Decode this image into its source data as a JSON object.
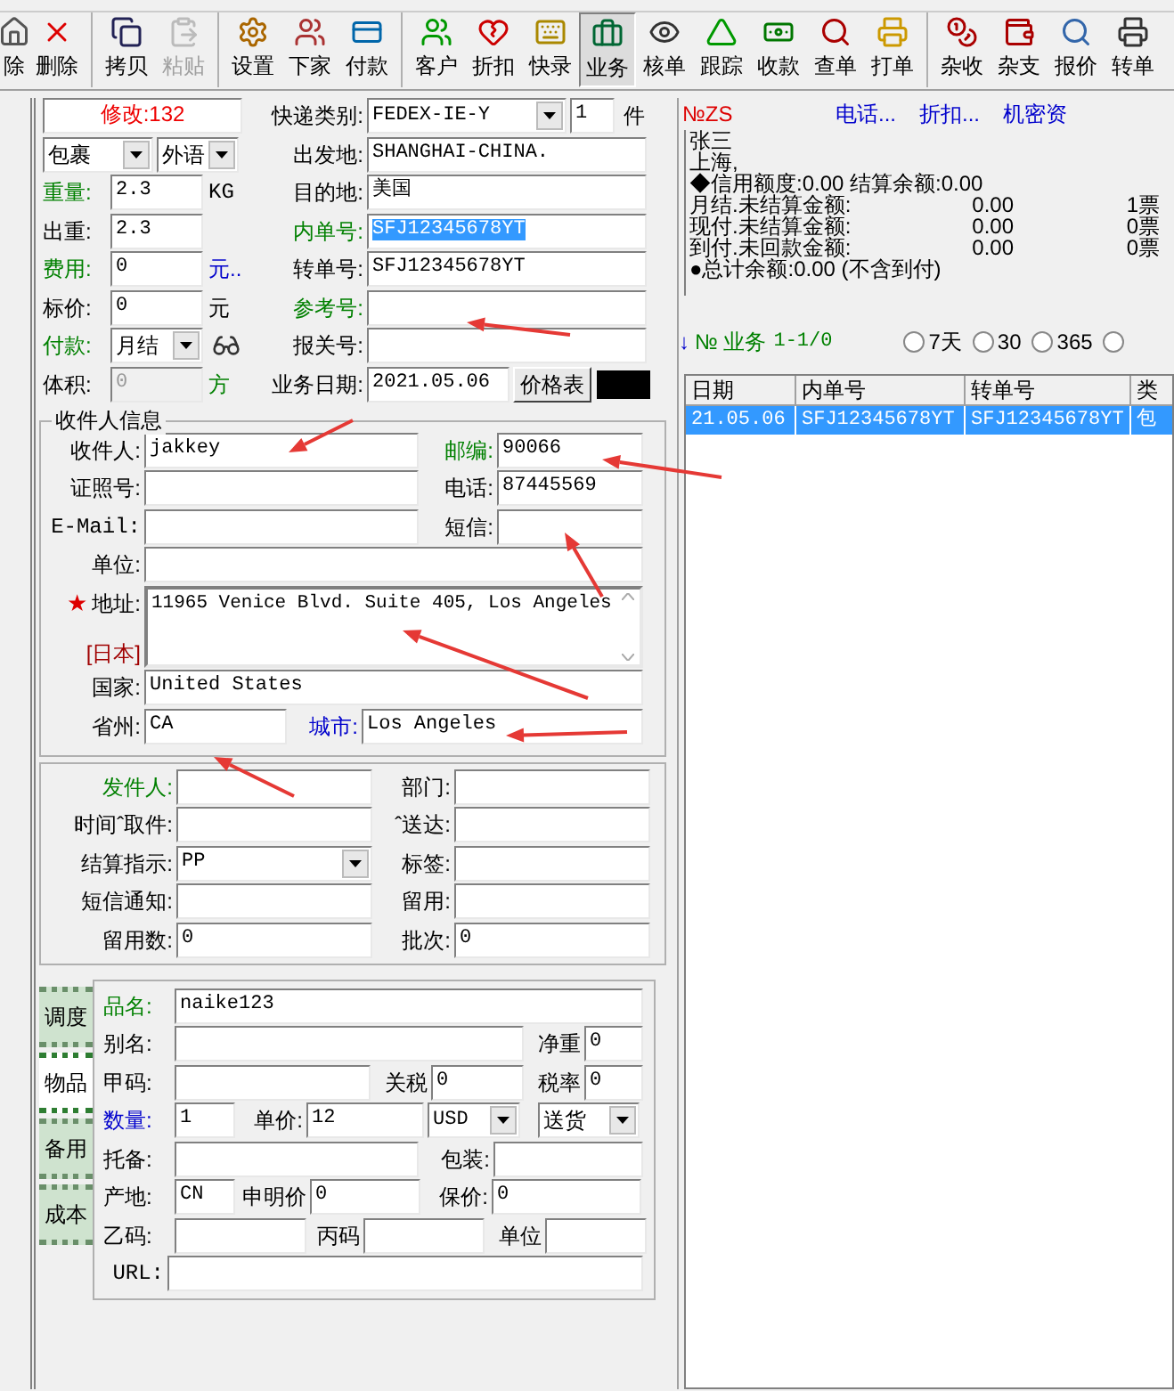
{
  "toolbar": {
    "groups": [
      [
        {
          "label": "除",
          "selected": false,
          "disabled": false
        },
        {
          "label": "删除",
          "selected": false,
          "disabled": false
        }
      ],
      [
        {
          "label": "拷贝",
          "selected": false,
          "disabled": false
        },
        {
          "label": "粘贴",
          "selected": false,
          "disabled": true
        }
      ],
      [
        {
          "label": "设置",
          "selected": false,
          "disabled": false
        },
        {
          "label": "下家",
          "selected": false,
          "disabled": false
        },
        {
          "label": "付款",
          "selected": false,
          "disabled": false
        }
      ],
      [
        {
          "label": "客户",
          "selected": false,
          "disabled": false
        },
        {
          "label": "折扣",
          "selected": false,
          "disabled": false
        },
        {
          "label": "快录",
          "selected": false,
          "disabled": false
        },
        {
          "label": "业务",
          "selected": true,
          "disabled": false
        },
        {
          "label": "核单",
          "selected": false,
          "disabled": false
        },
        {
          "label": "跟踪",
          "selected": false,
          "disabled": false
        },
        {
          "label": "收款",
          "selected": false,
          "disabled": false
        },
        {
          "label": "查单",
          "selected": false,
          "disabled": false
        },
        {
          "label": "打单",
          "selected": false,
          "disabled": false
        }
      ],
      [
        {
          "label": "杂收",
          "selected": false,
          "disabled": false
        },
        {
          "label": "杂支",
          "selected": false,
          "disabled": false
        },
        {
          "label": "报价",
          "selected": false,
          "disabled": false
        },
        {
          "label": "转单",
          "selected": false,
          "disabled": false
        }
      ]
    ]
  },
  "shipment": {
    "status": "修改:132",
    "express_type": {
      "label": "快递类别:",
      "value": "FEDEX-IE-Y"
    },
    "pieces": {
      "value": "1",
      "unit": "件"
    },
    "package_type": "包裹",
    "language": "外语",
    "origin": {
      "label": "出发地:",
      "value": "SHANGHAI-CHINA."
    },
    "weight": {
      "label": "重量:",
      "value": "2.3",
      "unit": "KG"
    },
    "destination": {
      "label": "目的地:",
      "value": "美国"
    },
    "out_weight": {
      "label": "出重:",
      "value": "2.3"
    },
    "internal_no": {
      "label": "内单号:",
      "value": "SFJ12345678YT",
      "selected": true
    },
    "fee": {
      "label": "费用:",
      "value": "0",
      "unit": "元.."
    },
    "transfer_no": {
      "label": "转单号:",
      "value": "SFJ12345678YT"
    },
    "list_price": {
      "label": "标价:",
      "value": "0",
      "unit": "元"
    },
    "reference_no": {
      "label": "参考号:"
    },
    "payment": {
      "label": "付款:",
      "value": "月结"
    },
    "customs_no": {
      "label": "报关号:"
    },
    "volume": {
      "label": "体积:",
      "value": "0",
      "unit": "方",
      "disabled": true
    },
    "business_date": {
      "label": "业务日期:",
      "value": "2021.05.06"
    },
    "price_table_button": "价格表"
  },
  "receiver": {
    "title": "收件人信息",
    "name": {
      "label": "收件人:",
      "value": "jakkey"
    },
    "postcode": {
      "label": "邮编:",
      "value": "90066"
    },
    "id_no": {
      "label": "证照号:"
    },
    "phone": {
      "label": "电话:",
      "value": "87445569"
    },
    "email": {
      "label": "E-Mail:"
    },
    "sms": {
      "label": "短信:"
    },
    "company": {
      "label": "单位:"
    },
    "address": {
      "required_mark": "★",
      "label": "地址:",
      "value": "11965 Venice Blvd. Suite 405, Los Angeles"
    },
    "region_tag": "[日本]",
    "country": {
      "label": "国家:",
      "value": "United States"
    },
    "state": {
      "label": "省州:",
      "value": "CA"
    },
    "city": {
      "label": "城市:",
      "value": "Los Angeles"
    }
  },
  "sender": {
    "rows": [
      [
        {
          "label": "发件人:",
          "kind": "input",
          "color": "#008000"
        },
        {
          "label": "部门:",
          "kind": "input"
        }
      ],
      [
        {
          "label": "时间ˆ取件:",
          "kind": "input"
        },
        {
          "label": "ˆ送达:",
          "kind": "input"
        }
      ],
      [
        {
          "label": "结算指示:",
          "kind": "select",
          "value": "PP"
        },
        {
          "label": "标签:",
          "kind": "input"
        }
      ],
      [
        {
          "label": "短信通知:",
          "kind": "input"
        },
        {
          "label": "留用:",
          "kind": "input"
        }
      ],
      [
        {
          "label": "留用数:",
          "kind": "input",
          "value": "0"
        },
        {
          "label": "批次:",
          "kind": "input",
          "value": "0"
        }
      ]
    ]
  },
  "item": {
    "tabs": [
      {
        "label": "调度",
        "selected": false
      },
      {
        "label": "物品",
        "selected": true
      },
      {
        "label": "备用",
        "selected": false
      },
      {
        "label": "成本",
        "selected": false
      }
    ],
    "name": {
      "label": "品名:",
      "value": "naike123"
    },
    "alias": {
      "label": "别名:"
    },
    "net_weight": {
      "label": "净重",
      "value": "0"
    },
    "code_a": {
      "label": "甲码:"
    },
    "duty": {
      "label": "关税",
      "value": "0"
    },
    "tax_rate": {
      "label": "税率",
      "value": "0"
    },
    "quantity": {
      "label": "数量:",
      "value": "1"
    },
    "unit_price": {
      "label": "单价:",
      "value": "12"
    },
    "currency": "USD",
    "delivery": "送货",
    "remark": {
      "label": "托备:"
    },
    "packing": {
      "label": "包装:"
    },
    "origin": {
      "label": "产地:",
      "value": "CN"
    },
    "declared_value": {
      "label": "申明价",
      "value": "0"
    },
    "insured_value": {
      "label": "保价:",
      "value": "0"
    },
    "code_b": {
      "label": "乙码:"
    },
    "code_c": {
      "label": "丙码"
    },
    "unit": {
      "label": "单位"
    },
    "url": {
      "label": "URL:"
    }
  },
  "customer": {
    "code": "№ZS",
    "links": [
      "电话...",
      "折扣...",
      "机密资"
    ],
    "lines": [
      "张三",
      "上海,",
      "◆信用额度:0.00 结算余额:0.00"
    ],
    "balances": [
      {
        "label": "月结.未结算金额:",
        "amount": "0.00",
        "count": "1票"
      },
      {
        "label": "现付.未结算金额:",
        "amount": "0.00",
        "count": "0票"
      },
      {
        "label": "到付.未回款金额:",
        "amount": "0.00",
        "count": "0票"
      }
    ],
    "total": "●总计余额:0.00 (不含到付)"
  },
  "business": {
    "arrow": "↓",
    "title": "№ 业务",
    "range": "1-1/0",
    "ranges": [
      {
        "label": "7天",
        "selected": false
      },
      {
        "label": "30",
        "selected": false
      },
      {
        "label": "365",
        "selected": false
      }
    ]
  },
  "table": {
    "columns": [
      "日期",
      "内单号",
      "转单号",
      "类"
    ],
    "rows": [
      {
        "cells": [
          "21.05.06",
          "SFJ12345678YT",
          "SFJ12345678YT",
          "包"
        ],
        "selected": true
      }
    ]
  }
}
